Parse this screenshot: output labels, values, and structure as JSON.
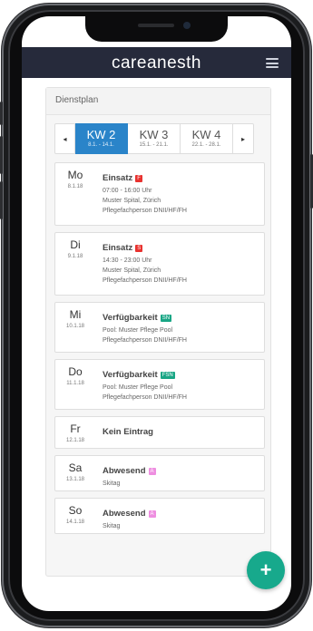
{
  "app": {
    "brand": "careanesth"
  },
  "card": {
    "title": "Dienstplan"
  },
  "week_nav": {
    "prev": "◂",
    "next": "▸",
    "weeks": [
      {
        "label": "KW 2",
        "range": "8.1. - 14.1.",
        "active": true
      },
      {
        "label": "KW 3",
        "range": "15.1. - 21.1.",
        "active": false
      },
      {
        "label": "KW 4",
        "range": "22.1. - 28.1.",
        "active": false
      }
    ]
  },
  "entries": [
    {
      "day": "Mo",
      "date": "8.1.18",
      "title": "Einsatz",
      "badge": "F",
      "badge_color": "#e8322f",
      "lines": [
        "07:00 - 16:00 Uhr",
        "Muster Spital, Zürich",
        "Pflegefachperson DNII/HF/FH"
      ]
    },
    {
      "day": "Di",
      "date": "9.1.18",
      "title": "Einsatz",
      "badge": "S",
      "badge_color": "#e8322f",
      "lines": [
        "14:30 - 23:00 Uhr",
        "Muster Spital, Zürich",
        "Pflegefachperson DNII/HF/FH"
      ]
    },
    {
      "day": "Mi",
      "date": "10.1.18",
      "title": "Verfügbarkeit",
      "badge": "SN",
      "badge_color": "#19a685",
      "lines": [
        "Pool: Muster Pflege Pool",
        "Pflegefachperson DNII/HF/FH"
      ]
    },
    {
      "day": "Do",
      "date": "11.1.18",
      "title": "Verfügbarkeit",
      "badge": "FSN",
      "badge_color": "#19a685",
      "lines": [
        "Pool: Muster Pflege Pool",
        "Pflegefachperson DNII/HF/FH"
      ]
    },
    {
      "day": "Fr",
      "date": "12.1.18",
      "title": "Kein Eintrag",
      "badge": "",
      "badge_color": "",
      "lines": []
    },
    {
      "day": "Sa",
      "date": "13.1.18",
      "title": "Abwesend",
      "badge": "A",
      "badge_color": "#ee8ee0",
      "lines": [
        "Skitag"
      ]
    },
    {
      "day": "So",
      "date": "14.1.18",
      "title": "Abwesend",
      "badge": "A",
      "badge_color": "#ee8ee0",
      "lines": [
        "Skitag"
      ]
    }
  ],
  "fab": {
    "icon": "plus-icon",
    "label": "+"
  }
}
